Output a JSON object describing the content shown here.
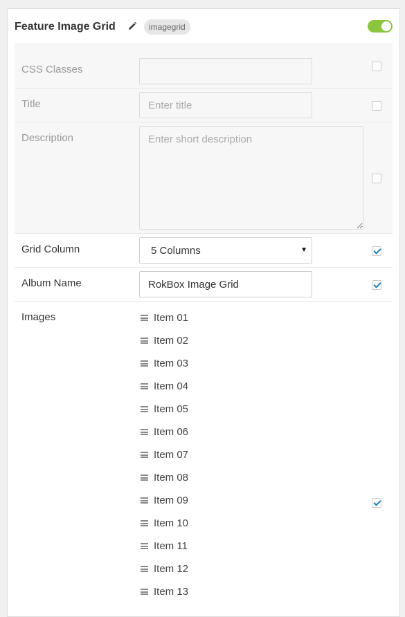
{
  "header": {
    "title": "Feature Image Grid",
    "tag": "imagegrid",
    "enabled": true,
    "accent_color": "#8cc63f"
  },
  "fields": {
    "css_classes": {
      "label": "CSS Classes",
      "value": "",
      "placeholder": "",
      "override": false
    },
    "title": {
      "label": "Title",
      "value": "",
      "placeholder": "Enter title",
      "override": false
    },
    "description": {
      "label": "Description",
      "value": "",
      "placeholder": "Enter short description",
      "override": false
    },
    "grid_column": {
      "label": "Grid Column",
      "value": "5 Columns",
      "override": true
    },
    "album_name": {
      "label": "Album Name",
      "value": "RokBox Image Grid",
      "override": true
    },
    "images": {
      "label": "Images",
      "override": true,
      "items": [
        "Item 01",
        "Item 02",
        "Item 03",
        "Item 04",
        "Item 05",
        "Item 06",
        "Item 07",
        "Item 08",
        "Item 09",
        "Item 10",
        "Item 11",
        "Item 12",
        "Item 13"
      ]
    }
  },
  "icons": {
    "edit": "pencil-icon",
    "drag": "drag-handle-icon",
    "select_arrow": "caret-down-icon"
  }
}
